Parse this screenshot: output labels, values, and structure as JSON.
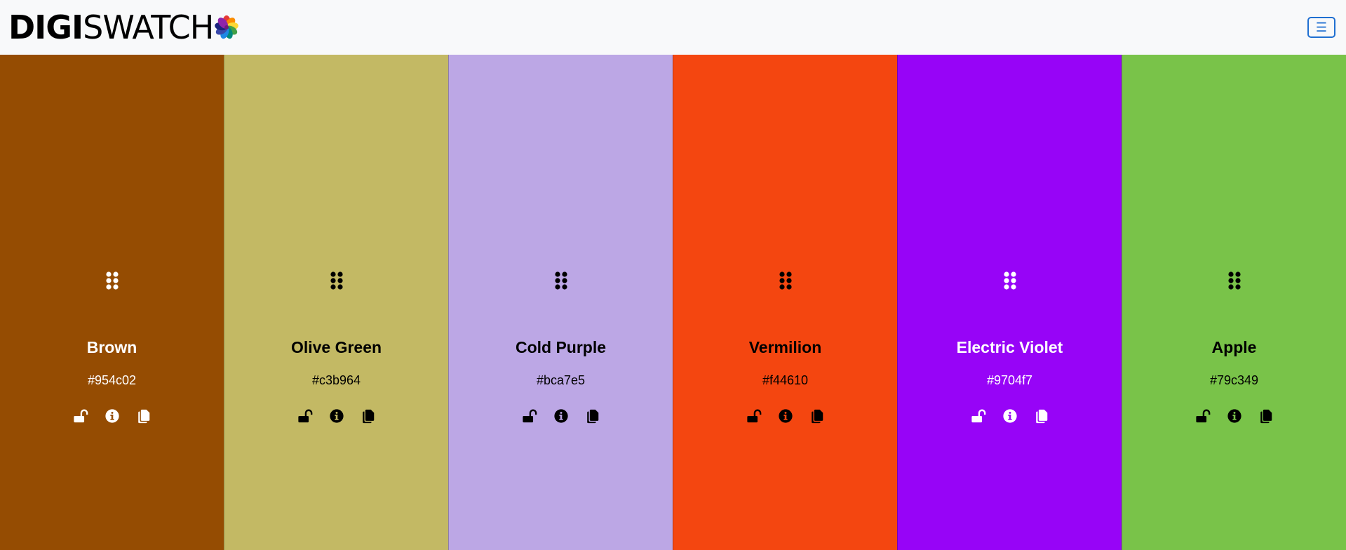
{
  "header": {
    "brand_bold": "DIGI",
    "brand_light": "SWATCH",
    "logo_icon": "color-wheel-icon",
    "menu_icon": "hamburger-menu-icon",
    "menu_glyph": "☰",
    "accent_color": "#1f6fd1"
  },
  "swatches": [
    {
      "name": "Brown",
      "hex": "#954c02",
      "background": "#954c02",
      "text_color": "#ffffff",
      "locked": false
    },
    {
      "name": "Olive Green",
      "hex": "#c3b964",
      "background": "#c3b964",
      "text_color": "#000000",
      "locked": false
    },
    {
      "name": "Cold Purple",
      "hex": "#bca7e5",
      "background": "#bca7e5",
      "text_color": "#000000",
      "locked": false
    },
    {
      "name": "Vermilion",
      "hex": "#f44610",
      "background": "#f44610",
      "text_color": "#000000",
      "locked": false
    },
    {
      "name": "Electric Violet",
      "hex": "#9704f7",
      "background": "#9704f7",
      "text_color": "#ffffff",
      "locked": false
    },
    {
      "name": "Apple",
      "hex": "#79c349",
      "background": "#79c349",
      "text_color": "#000000",
      "locked": false
    }
  ],
  "swatch_icons": [
    "drag-handle-icon",
    "unlock-icon",
    "info-icon",
    "copy-icon"
  ]
}
